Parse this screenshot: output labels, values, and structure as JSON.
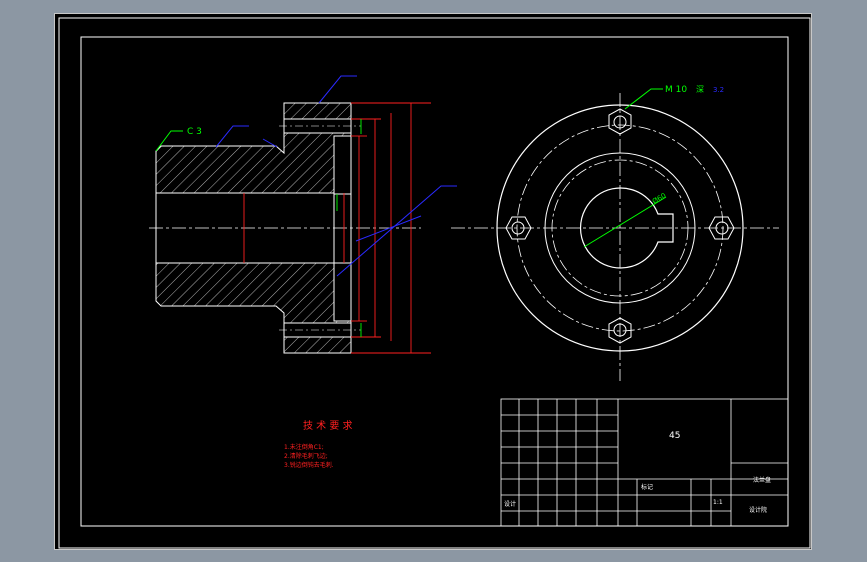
{
  "colors": {
    "background": "#000000",
    "frame": "#ffffff",
    "annotation": "#00ff00",
    "dimension": "#ff2020",
    "leader": "#2a2aff",
    "title_background": "#8c97a3"
  },
  "annotations": {
    "chamfer": "C 3",
    "thread": "M 10",
    "thread_suffix": "深",
    "roughness_value": "3.2",
    "hub_diameter": "Ø60"
  },
  "tech_requirements": {
    "title": "技 术 要 求",
    "items": [
      "1.未注倒角C1;",
      "2.清除毛刺飞边;",
      "3.锐边倒钝去毛刺."
    ]
  },
  "title_block": {
    "material": "45",
    "drawing_name": "法兰盘",
    "scale": "1:1",
    "school": "设计院",
    "rev_label": "标记",
    "designer": "设计"
  }
}
